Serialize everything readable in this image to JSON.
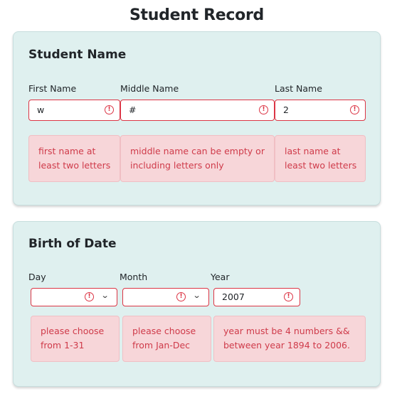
{
  "page": {
    "title": "Student Record"
  },
  "name_section": {
    "title": "Student Name",
    "first": {
      "label": "First Name",
      "value": "w",
      "error": "first name at least two letters"
    },
    "middle": {
      "label": "Middle Name",
      "value": "#",
      "error": "middle name can be empty or including letters only"
    },
    "last": {
      "label": "Last Name",
      "value": "2",
      "error": "last name at least two letters"
    }
  },
  "birth_section": {
    "title": "Birth of Date",
    "day": {
      "label": "Day",
      "value": "",
      "error": "please choose from 1-31"
    },
    "month": {
      "label": "Month",
      "value": "",
      "error": "please choose from Jan-Dec"
    },
    "year": {
      "label": "Year",
      "value": "2007",
      "error": "year must be 4 numbers && between year 1894 to 2006."
    }
  },
  "icons": {
    "error": "exclamation-circle-icon",
    "dropdown": "chevron-down-icon"
  },
  "colors": {
    "card_bg": "#dff0ef",
    "error": "#dc3545",
    "error_bg": "#f7d6d9",
    "error_text": "#cf3b4a"
  }
}
